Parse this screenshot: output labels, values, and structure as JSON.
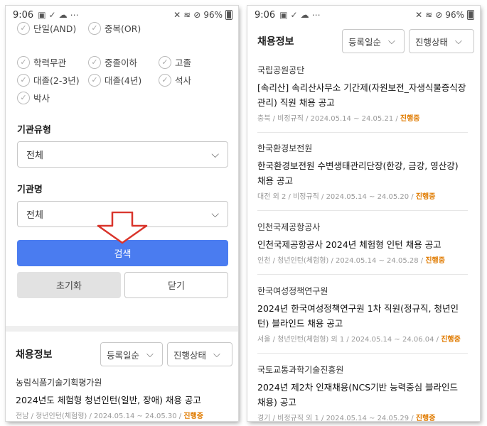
{
  "status": {
    "time": "9:06",
    "battery": "96%"
  },
  "filters": {
    "top_row": [
      "단일(AND)",
      "중복(OR)"
    ],
    "education": [
      "학력무관",
      "중졸이하",
      "고졸",
      "대졸(2-3년)",
      "대졸(4년)",
      "석사",
      "박사"
    ],
    "agency_type_label": "기관유형",
    "agency_type_value": "전체",
    "agency_name_label": "기관명",
    "agency_name_value": "전체",
    "search_label": "검색",
    "reset_label": "초기화",
    "close_label": "닫기"
  },
  "list_header": {
    "title": "채용정보",
    "sort": "등록일순",
    "progress": "진행상태"
  },
  "left_jobs": [
    {
      "org": "농림식품기술기획평가원",
      "title": "2024년도 체험형 청년인턴(일반, 장애) 채용 공고",
      "meta": "전남 / 청년인턴(체험형) / 2024.05.14 ~ 24.05.30 / ",
      "status": "진행중"
    }
  ],
  "right_jobs": [
    {
      "org": "국립공원공단",
      "title": "[속리산] 속리산사무소 기간제(자원보전_자생식물증식장 관리) 직원 채용 공고",
      "meta": "충북 / 비정규직 / 2024.05.14 ~ 24.05.21 / ",
      "status": "진행중"
    },
    {
      "org": "한국환경보전원",
      "title": "한국환경보전원 수변생태관리단장(한강, 금강, 영산강) 채용 공고",
      "meta": "대전 외 2 / 비정규직 / 2024.05.14 ~ 24.05.20 / ",
      "status": "진행중"
    },
    {
      "org": "인천국제공항공사",
      "title": "인천국제공항공사 2024년 체험형 인턴 채용 공고",
      "meta": "인천 / 청년인턴(체험형) / 2024.05.14 ~ 24.05.28 / ",
      "status": "진행중"
    },
    {
      "org": "한국여성정책연구원",
      "title": "2024년 한국여성정책연구원 1차 직원(정규직, 청년인턴) 블라인드 채용 공고",
      "meta": "서울 / 청년인턴(체험형) 외 1 / 2024.05.14 ~ 24.06.04 / ",
      "status": "진행중"
    },
    {
      "org": "국토교통과학기술진흥원",
      "title": "2024년 제2차 인재채용(NCS기반 능력중심 블라인드 채용) 공고",
      "meta": "경기 / 비정규직 외 1 / 2024.05.14 ~ 24.05.29 / ",
      "status": "진행중"
    }
  ],
  "colors": {
    "primary": "#4a7cf0",
    "status": "#e07b00",
    "arrow": "#d9342b"
  }
}
